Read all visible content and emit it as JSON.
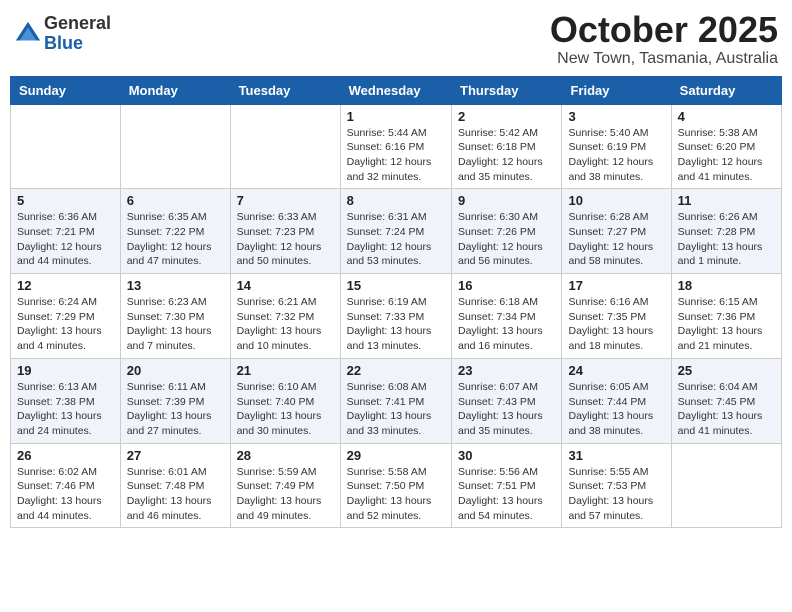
{
  "header": {
    "logo_general": "General",
    "logo_blue": "Blue",
    "month_title": "October 2025",
    "location": "New Town, Tasmania, Australia"
  },
  "weekdays": [
    "Sunday",
    "Monday",
    "Tuesday",
    "Wednesday",
    "Thursday",
    "Friday",
    "Saturday"
  ],
  "weeks": [
    [
      {
        "day": "",
        "info": ""
      },
      {
        "day": "",
        "info": ""
      },
      {
        "day": "",
        "info": ""
      },
      {
        "day": "1",
        "info": "Sunrise: 5:44 AM\nSunset: 6:16 PM\nDaylight: 12 hours\nand 32 minutes."
      },
      {
        "day": "2",
        "info": "Sunrise: 5:42 AM\nSunset: 6:18 PM\nDaylight: 12 hours\nand 35 minutes."
      },
      {
        "day": "3",
        "info": "Sunrise: 5:40 AM\nSunset: 6:19 PM\nDaylight: 12 hours\nand 38 minutes."
      },
      {
        "day": "4",
        "info": "Sunrise: 5:38 AM\nSunset: 6:20 PM\nDaylight: 12 hours\nand 41 minutes."
      }
    ],
    [
      {
        "day": "5",
        "info": "Sunrise: 6:36 AM\nSunset: 7:21 PM\nDaylight: 12 hours\nand 44 minutes."
      },
      {
        "day": "6",
        "info": "Sunrise: 6:35 AM\nSunset: 7:22 PM\nDaylight: 12 hours\nand 47 minutes."
      },
      {
        "day": "7",
        "info": "Sunrise: 6:33 AM\nSunset: 7:23 PM\nDaylight: 12 hours\nand 50 minutes."
      },
      {
        "day": "8",
        "info": "Sunrise: 6:31 AM\nSunset: 7:24 PM\nDaylight: 12 hours\nand 53 minutes."
      },
      {
        "day": "9",
        "info": "Sunrise: 6:30 AM\nSunset: 7:26 PM\nDaylight: 12 hours\nand 56 minutes."
      },
      {
        "day": "10",
        "info": "Sunrise: 6:28 AM\nSunset: 7:27 PM\nDaylight: 12 hours\nand 58 minutes."
      },
      {
        "day": "11",
        "info": "Sunrise: 6:26 AM\nSunset: 7:28 PM\nDaylight: 13 hours\nand 1 minute."
      }
    ],
    [
      {
        "day": "12",
        "info": "Sunrise: 6:24 AM\nSunset: 7:29 PM\nDaylight: 13 hours\nand 4 minutes."
      },
      {
        "day": "13",
        "info": "Sunrise: 6:23 AM\nSunset: 7:30 PM\nDaylight: 13 hours\nand 7 minutes."
      },
      {
        "day": "14",
        "info": "Sunrise: 6:21 AM\nSunset: 7:32 PM\nDaylight: 13 hours\nand 10 minutes."
      },
      {
        "day": "15",
        "info": "Sunrise: 6:19 AM\nSunset: 7:33 PM\nDaylight: 13 hours\nand 13 minutes."
      },
      {
        "day": "16",
        "info": "Sunrise: 6:18 AM\nSunset: 7:34 PM\nDaylight: 13 hours\nand 16 minutes."
      },
      {
        "day": "17",
        "info": "Sunrise: 6:16 AM\nSunset: 7:35 PM\nDaylight: 13 hours\nand 18 minutes."
      },
      {
        "day": "18",
        "info": "Sunrise: 6:15 AM\nSunset: 7:36 PM\nDaylight: 13 hours\nand 21 minutes."
      }
    ],
    [
      {
        "day": "19",
        "info": "Sunrise: 6:13 AM\nSunset: 7:38 PM\nDaylight: 13 hours\nand 24 minutes."
      },
      {
        "day": "20",
        "info": "Sunrise: 6:11 AM\nSunset: 7:39 PM\nDaylight: 13 hours\nand 27 minutes."
      },
      {
        "day": "21",
        "info": "Sunrise: 6:10 AM\nSunset: 7:40 PM\nDaylight: 13 hours\nand 30 minutes."
      },
      {
        "day": "22",
        "info": "Sunrise: 6:08 AM\nSunset: 7:41 PM\nDaylight: 13 hours\nand 33 minutes."
      },
      {
        "day": "23",
        "info": "Sunrise: 6:07 AM\nSunset: 7:43 PM\nDaylight: 13 hours\nand 35 minutes."
      },
      {
        "day": "24",
        "info": "Sunrise: 6:05 AM\nSunset: 7:44 PM\nDaylight: 13 hours\nand 38 minutes."
      },
      {
        "day": "25",
        "info": "Sunrise: 6:04 AM\nSunset: 7:45 PM\nDaylight: 13 hours\nand 41 minutes."
      }
    ],
    [
      {
        "day": "26",
        "info": "Sunrise: 6:02 AM\nSunset: 7:46 PM\nDaylight: 13 hours\nand 44 minutes."
      },
      {
        "day": "27",
        "info": "Sunrise: 6:01 AM\nSunset: 7:48 PM\nDaylight: 13 hours\nand 46 minutes."
      },
      {
        "day": "28",
        "info": "Sunrise: 5:59 AM\nSunset: 7:49 PM\nDaylight: 13 hours\nand 49 minutes."
      },
      {
        "day": "29",
        "info": "Sunrise: 5:58 AM\nSunset: 7:50 PM\nDaylight: 13 hours\nand 52 minutes."
      },
      {
        "day": "30",
        "info": "Sunrise: 5:56 AM\nSunset: 7:51 PM\nDaylight: 13 hours\nand 54 minutes."
      },
      {
        "day": "31",
        "info": "Sunrise: 5:55 AM\nSunset: 7:53 PM\nDaylight: 13 hours\nand 57 minutes."
      },
      {
        "day": "",
        "info": ""
      }
    ]
  ]
}
